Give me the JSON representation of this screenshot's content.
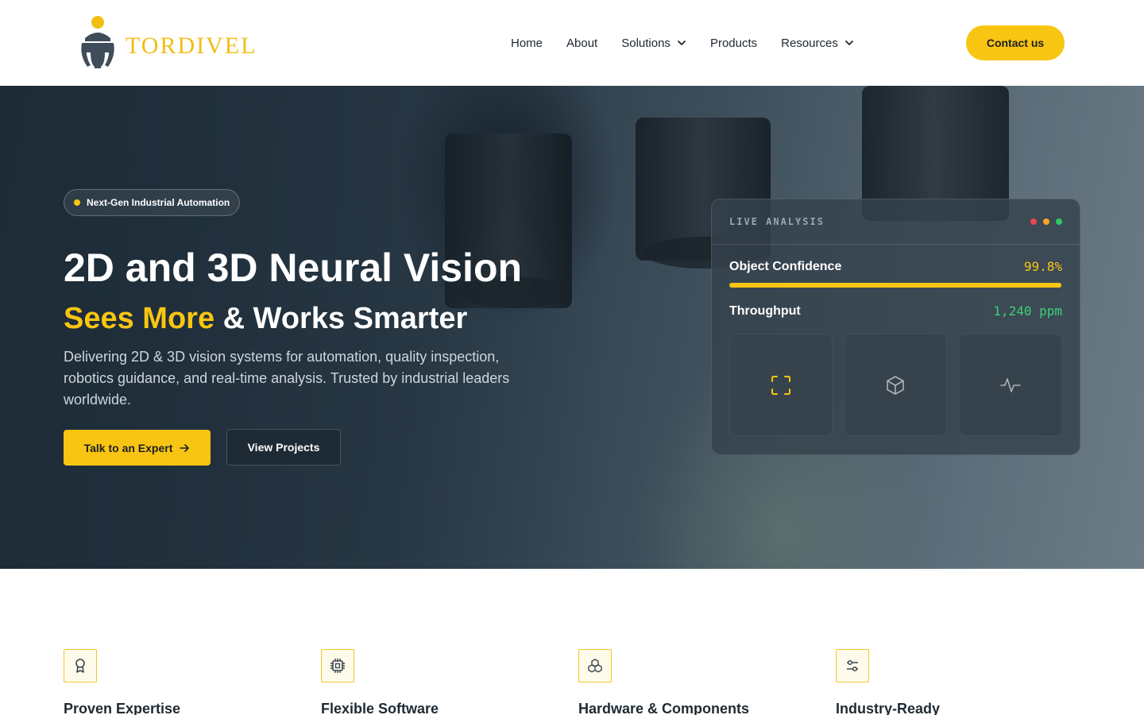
{
  "brand": {
    "name": "TORDIVEL",
    "accent": "#f9c513",
    "logo_icon": "beetle-logo"
  },
  "nav": {
    "items": [
      {
        "label": "Home",
        "has_dropdown": false
      },
      {
        "label": "About",
        "has_dropdown": false
      },
      {
        "label": "Solutions",
        "has_dropdown": true
      },
      {
        "label": "Products",
        "has_dropdown": false
      },
      {
        "label": "Resources",
        "has_dropdown": true
      }
    ],
    "contact_label": "Contact us"
  },
  "hero": {
    "badge": "Next-Gen Industrial Automation",
    "title": "2D and 3D Neural Vision",
    "subtitle_highlight": "Sees More",
    "subtitle_rest": " & Works Smarter",
    "description": "Delivering 2D & 3D vision systems for automation, quality inspection, robotics guidance, and real-time analysis. Trusted by industrial leaders worldwide.",
    "primary_cta": "Talk to an Expert",
    "secondary_cta": "View Projects"
  },
  "analysis_card": {
    "title": "LIVE ANALYSIS",
    "window_dots": [
      "#e5484d",
      "#f5a623",
      "#30c75b"
    ],
    "confidence_label": "Object Confidence",
    "confidence_value": "99.8%",
    "confidence_fraction": 0.998,
    "confidence_color": "#f9c513",
    "throughput_label": "Throughput",
    "throughput_value": "1,240 ppm",
    "throughput_color": "#3ecf74",
    "tiles": [
      "scan-frame-icon",
      "cube-icon",
      "activity-pulse-icon"
    ]
  },
  "features": [
    {
      "icon": "award-icon",
      "title": "Proven Expertise"
    },
    {
      "icon": "cpu-chip-icon",
      "title": "Flexible Software"
    },
    {
      "icon": "components-icon",
      "title": "Hardware & Components"
    },
    {
      "icon": "sliders-icon",
      "title": "Industry-Ready"
    }
  ]
}
